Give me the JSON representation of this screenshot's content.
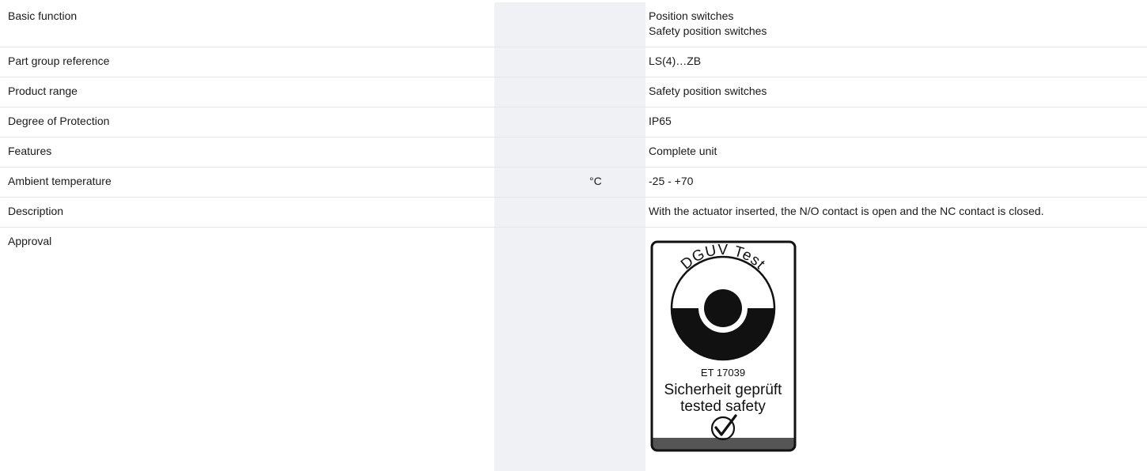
{
  "rows": [
    {
      "label": "Basic function",
      "unit": "",
      "values": [
        "Position switches",
        "Safety position switches"
      ]
    },
    {
      "label": "Part group reference",
      "unit": "",
      "values": [
        "LS(4)…ZB"
      ]
    },
    {
      "label": "Product range",
      "unit": "",
      "values": [
        "Safety position switches"
      ]
    },
    {
      "label": "Degree of Protection",
      "unit": "",
      "values": [
        "IP65"
      ]
    },
    {
      "label": "Features",
      "unit": "",
      "values": [
        "Complete unit"
      ]
    },
    {
      "label": "Ambient temperature",
      "unit": "°C",
      "values": [
        "-25 - +70"
      ]
    },
    {
      "label": "Description",
      "unit": "",
      "values": [
        "With the actuator inserted, the N/O contact is open and the NC contact is closed."
      ]
    },
    {
      "label": "Approval",
      "unit": "",
      "values": []
    }
  ],
  "approval_badge": {
    "arc_text": "DGUV Test",
    "cert_number": "ET 17039",
    "line_de": "Sicherheit geprüft",
    "line_en": "tested safety",
    "icon": "check-circle-icon"
  },
  "colors": {
    "shaded_column": "#eff1f4",
    "row_divider": "#e4e6ea",
    "badge_dark": "#111111",
    "badge_footer": "#555555"
  }
}
